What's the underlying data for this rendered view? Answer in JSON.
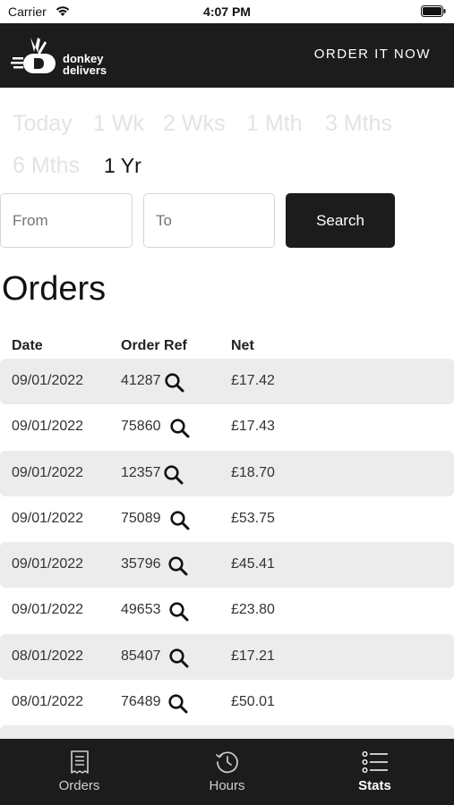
{
  "status_bar": {
    "carrier": "Carrier",
    "time": "4:07 PM"
  },
  "header": {
    "logo_text_line1": "donkey",
    "logo_text_line2": "delivers",
    "order_link": "ORDER IT NOW",
    "background_color": "#1c1c1c"
  },
  "periods": [
    "Today",
    "1 Wk",
    "2 Wks",
    "1 Mth",
    "3 Mths",
    "6 Mths",
    "1 Yr"
  ],
  "selected_period": "1 Yr",
  "filters": {
    "from_placeholder": "From",
    "to_placeholder": "To",
    "search_label": "Search"
  },
  "page_title": "Orders",
  "table": {
    "columns": [
      "Date",
      "Order Ref",
      "Net"
    ],
    "rows": [
      {
        "date": "09/01/2022",
        "ref": "41287",
        "net": "£17.42"
      },
      {
        "date": "09/01/2022",
        "ref": "75860",
        "net": "£17.43"
      },
      {
        "date": "09/01/2022",
        "ref": "12357",
        "net": "£18.70"
      },
      {
        "date": "09/01/2022",
        "ref": "75089",
        "net": "£53.75"
      },
      {
        "date": "09/01/2022",
        "ref": "35796",
        "net": "£45.41"
      },
      {
        "date": "09/01/2022",
        "ref": "49653",
        "net": "£23.80"
      },
      {
        "date": "08/01/2022",
        "ref": "85407",
        "net": "£17.21"
      },
      {
        "date": "08/01/2022",
        "ref": "76489",
        "net": "£50.01"
      }
    ]
  },
  "tabs": [
    {
      "label": "Orders",
      "icon": "receipt-icon"
    },
    {
      "label": "Hours",
      "icon": "clock-history-icon"
    },
    {
      "label": "Stats",
      "icon": "list-icon"
    }
  ],
  "active_tab": "Stats"
}
